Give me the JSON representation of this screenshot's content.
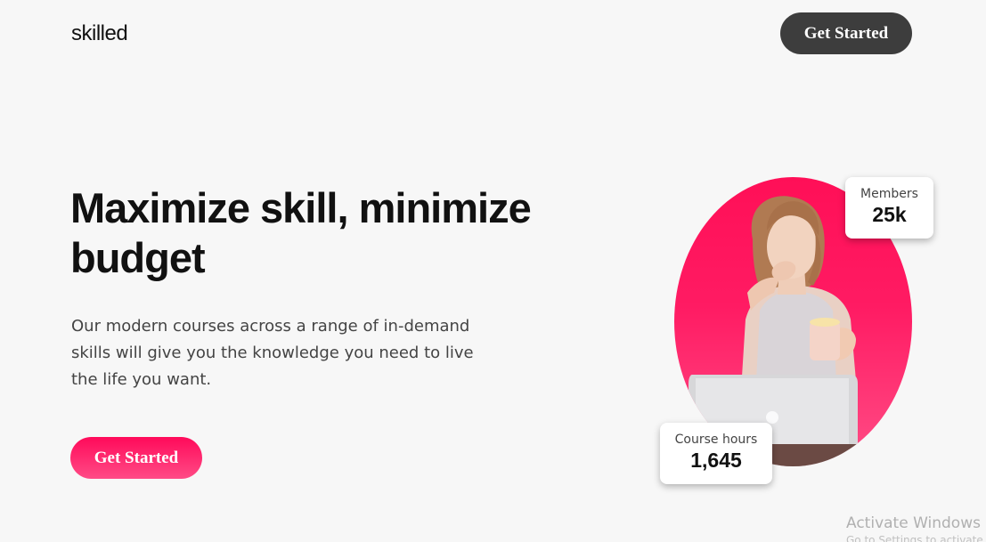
{
  "nav": {
    "logo": "skilled",
    "cta_label": "Get Started"
  },
  "hero": {
    "title": "Maximize skill, minimize budget",
    "description": "Our modern courses across a range of in-demand skills will give you the knowledge you need to live the life you want.",
    "cta_label": "Get Started"
  },
  "stats": {
    "members": {
      "label": "Members",
      "value": "25k"
    },
    "course_hours": {
      "label": "Course hours",
      "value": "1,645"
    }
  },
  "os_overlay": {
    "watermark": "Activate Windows",
    "watermark_sub": "Go to Settings to activate Windows."
  },
  "colors": {
    "accent": "#ff0a5a",
    "dark_button": "#3d3d3d",
    "background": "#f7f7f7"
  }
}
